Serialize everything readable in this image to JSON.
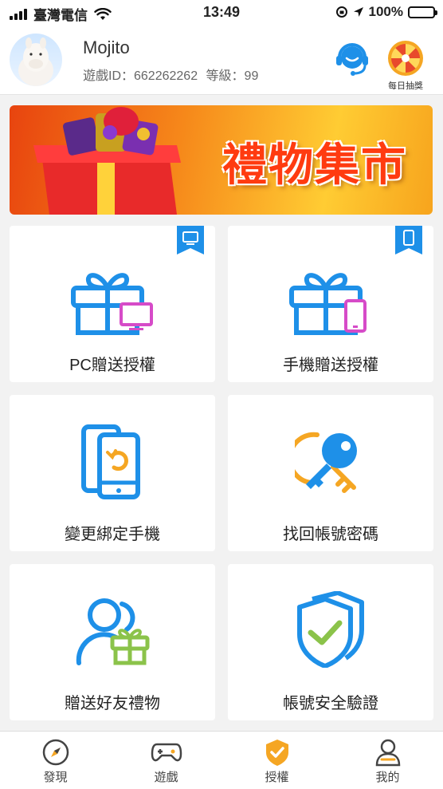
{
  "status": {
    "carrier": "臺灣電信",
    "time": "13:49",
    "battery": "100%"
  },
  "profile": {
    "name": "Mojito",
    "id_label": "遊戲ID：662262262",
    "level_label": "等級：99"
  },
  "header_actions": {
    "lottery_label": "每日抽獎"
  },
  "banner": {
    "title": "禮物集市"
  },
  "cards": [
    {
      "label": "PC贈送授權"
    },
    {
      "label": "手機贈送授權"
    },
    {
      "label": "變更綁定手機"
    },
    {
      "label": "找回帳號密碼"
    },
    {
      "label": "贈送好友禮物"
    },
    {
      "label": "帳號安全驗證"
    }
  ],
  "tabs": [
    {
      "label": "發現",
      "icon": "compass-icon"
    },
    {
      "label": "遊戲",
      "icon": "gamepad-icon"
    },
    {
      "label": "授權",
      "icon": "shield-check-icon",
      "active": true
    },
    {
      "label": "我的",
      "icon": "user-icon"
    }
  ],
  "colors": {
    "accent_blue": "#1e90e8",
    "accent_orange": "#f5a623",
    "accent_magenta": "#d64bc8",
    "accent_green": "#8bc34a"
  }
}
